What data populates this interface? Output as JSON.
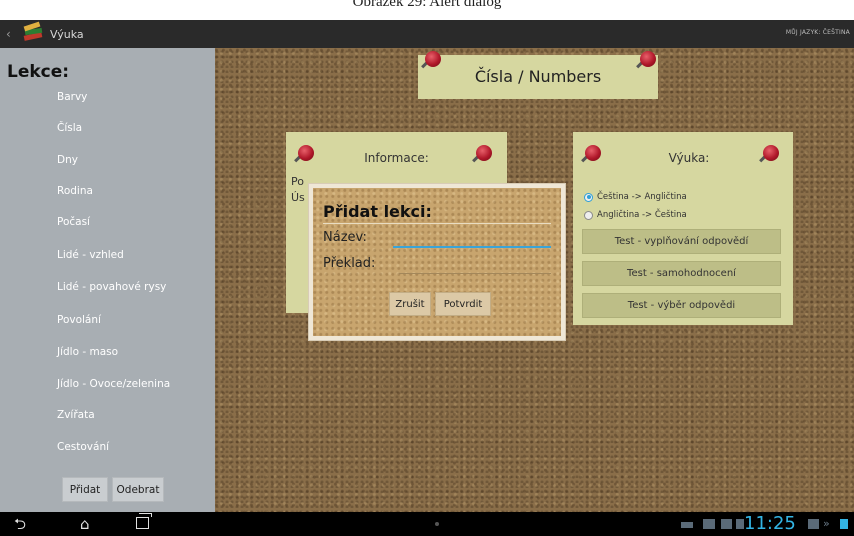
{
  "caption": "Obrázek 29: Alert dialog",
  "actionbar": {
    "back_glyph": "‹",
    "app_name": "Výuka",
    "language_label": "MŮJ JAZYK: ČEŠTINA"
  },
  "sidebar": {
    "title": "Lekce:",
    "lessons": [
      "Barvy",
      "Čísla",
      "Dny",
      "Rodina",
      "Počasí",
      "Lidé - vzhled",
      "Lidé - povahové rysy",
      "Povolání",
      "Jídlo - maso",
      "Jídlo - Ovoce/zelenina",
      "Zvířata",
      "Cestování"
    ],
    "add_label": "Přidat",
    "remove_label": "Odebrat"
  },
  "board": {
    "lesson_title": "Čísla / Numbers",
    "info": {
      "header": "Informace:",
      "line1": "Po",
      "line2": "Ús"
    },
    "vyuka": {
      "header": "Výuka:",
      "direction_options": [
        "Čeština -> Angličtina",
        "Angličtina -> Čeština"
      ],
      "selected_index": 0,
      "tests": [
        "Test - vyplňování odpovědí",
        "Test - samohodnocení",
        "Test - výběr odpovědi"
      ]
    }
  },
  "dialog": {
    "title": "Přidat lekci:",
    "name_label": "Název:",
    "name_value": "",
    "translation_label": "Překlad:",
    "translation_value": "",
    "cancel_label": "Zrušit",
    "confirm_label": "Potvrdit"
  },
  "statusbar": {
    "time": "11:25",
    "accent_color": "#33b5e5"
  }
}
